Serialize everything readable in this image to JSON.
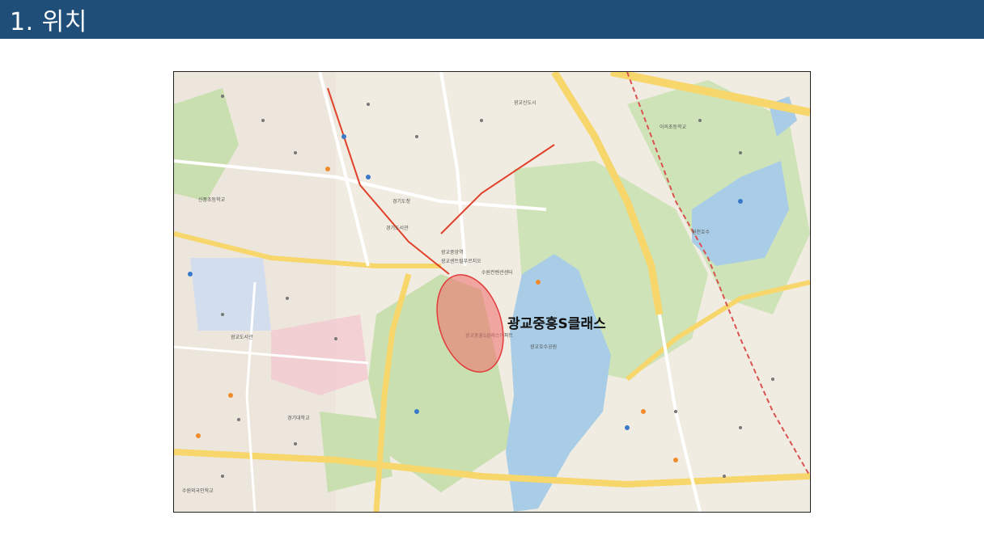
{
  "header": {
    "title": "1. 위치"
  },
  "map": {
    "callout_label": "광교중흥S클래스",
    "highlight_color": "#e33a3a",
    "water_color": "#a9cde6",
    "park_color": "#c9dfb0",
    "road_color": "#f7d66b",
    "labels": [
      "경기도청",
      "광교중흥S클래스아파트",
      "광교호수공원",
      "원천호수",
      "경기도서관",
      "광교중앙역",
      "광교센트럴푸르지오",
      "수원컨벤션센터",
      "광교신도시",
      "이의초등학교",
      "신풍초등학교",
      "광교도서관",
      "경기대학교",
      "수원외국인학교"
    ]
  }
}
